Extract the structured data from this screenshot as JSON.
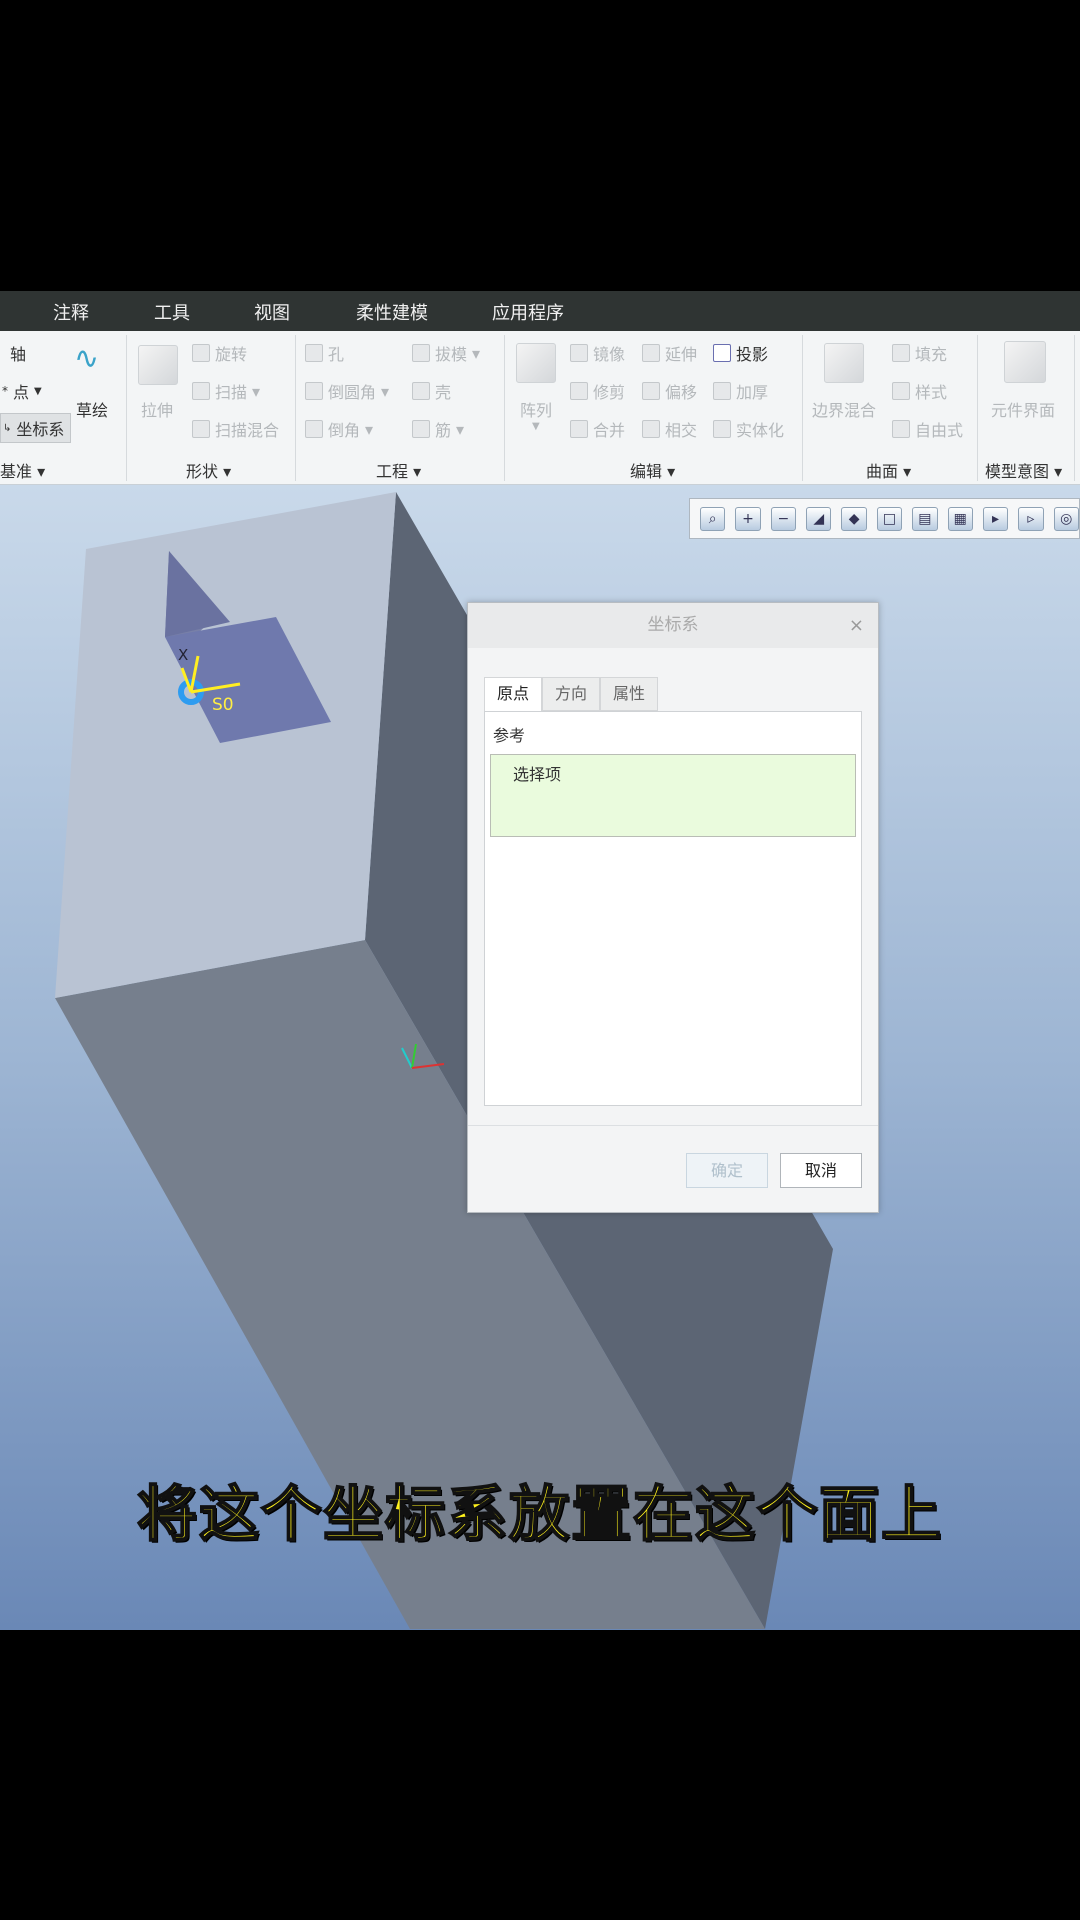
{
  "menubar": {
    "items": [
      "注释",
      "工具",
      "视图",
      "柔性建模",
      "应用程序"
    ]
  },
  "ribbon": {
    "datum": {
      "axis": "轴",
      "point": "点",
      "csys": "坐标系",
      "sketch": "草绘",
      "group": "基准"
    },
    "shapes": {
      "extrude": "拉伸",
      "revolve": "旋转",
      "sweep": "扫描",
      "swept_blend": "扫描混合",
      "group": "形状"
    },
    "engineering": {
      "hole": "孔",
      "draft": "拔模",
      "round": "倒圆角",
      "shell": "壳",
      "chamfer": "倒角",
      "rib": "筋",
      "group": "工程"
    },
    "editing": {
      "pattern": "阵列",
      "mirror": "镜像",
      "extend": "延伸",
      "project": "投影",
      "trim": "修剪",
      "offset": "偏移",
      "thicken": "加厚",
      "merge": "合并",
      "intersect": "相交",
      "solidify": "实体化",
      "group": "编辑"
    },
    "surfaces": {
      "boundary_blend": "边界混合",
      "fill": "填充",
      "style": "样式",
      "freestyle": "自由式",
      "group": "曲面"
    },
    "model_intent": {
      "component_interface": "元件界面",
      "group": "模型意图"
    }
  },
  "viewport": {
    "csys_label": "S0",
    "axis_label": "X"
  },
  "dialog": {
    "title": "坐标系",
    "close": "×",
    "tabs": [
      "原点",
      "方向",
      "属性"
    ],
    "active_tab": "原点",
    "ref_label": "参考",
    "ref_placeholder": "选择项",
    "ok": "确定",
    "cancel": "取消"
  },
  "subtitle": "将这个坐标系放置在这个面上",
  "colors": {
    "ref_list_bg": "#eafbdd",
    "subtitle": "#fff21c",
    "menubar": "#2f3433"
  }
}
